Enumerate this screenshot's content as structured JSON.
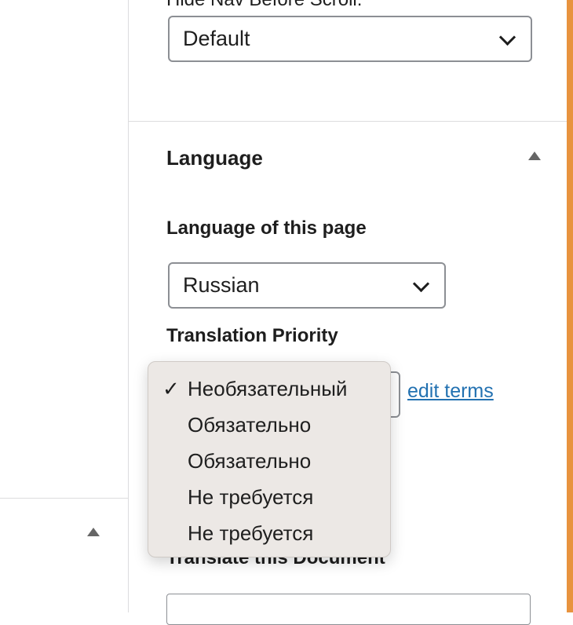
{
  "hide_nav": {
    "label": "Hide Nav Before Scroll:",
    "selected": "Default"
  },
  "language_section": {
    "title": "Language",
    "page_language_label": "Language of this page",
    "page_language_value": "Russian",
    "priority_label": "Translation Priority",
    "edit_terms_link": "edit terms",
    "priority_options": [
      {
        "label": "Необязательный",
        "selected": true
      },
      {
        "label": "Обязательно",
        "selected": false
      },
      {
        "label": "Обязательно",
        "selected": false
      },
      {
        "label": "Не требуется",
        "selected": false
      },
      {
        "label": "Не требуется",
        "selected": false
      }
    ],
    "translate_label": "Translate this Document"
  },
  "icons": {
    "checkmark": "✓",
    "collapse": "triangle-up-icon",
    "dropdown": "chevron-down-icon"
  },
  "colors": {
    "link": "#2271b1",
    "dropdown_bg": "#ece8e5",
    "accent_edge": "#e8933e"
  }
}
